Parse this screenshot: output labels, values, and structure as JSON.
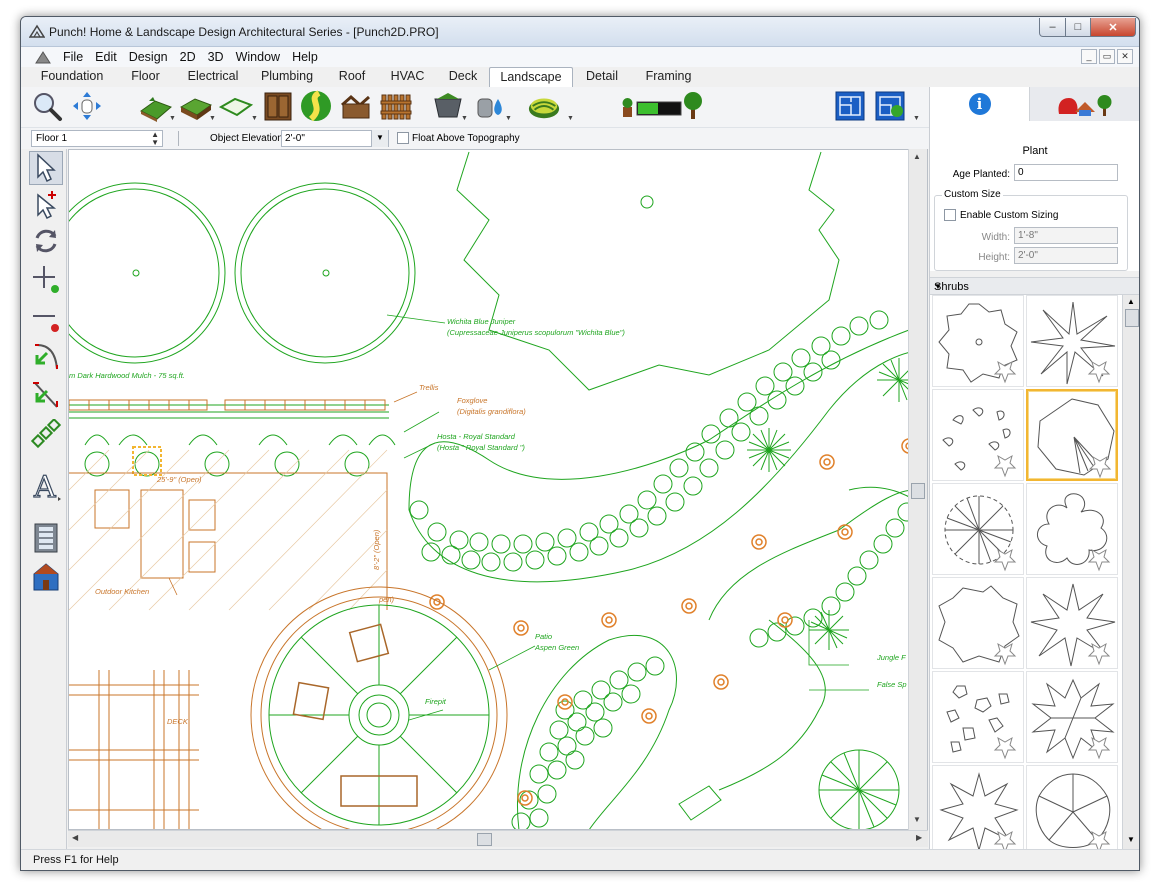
{
  "window": {
    "title": "Punch! Home & Landscape Design Architectural Series - [Punch2D.PRO]",
    "min": "–",
    "max": "□",
    "close": "✕"
  },
  "menu": [
    "File",
    "Edit",
    "Design",
    "2D",
    "3D",
    "Window",
    "Help"
  ],
  "mdi_buttons": [
    "_",
    "▭",
    "✕"
  ],
  "tabs": [
    {
      "label": "Foundation",
      "active": false
    },
    {
      "label": "Floor",
      "active": false
    },
    {
      "label": "Electrical",
      "active": false
    },
    {
      "label": "Plumbing",
      "active": false
    },
    {
      "label": "Roof",
      "active": false
    },
    {
      "label": "HVAC",
      "active": false
    },
    {
      "label": "Deck",
      "active": false
    },
    {
      "label": "Landscape",
      "active": true
    },
    {
      "label": "Detail",
      "active": false
    },
    {
      "label": "Framing",
      "active": false
    }
  ],
  "toolbar": {
    "tools": [
      "zoom-icon",
      "pan-icon",
      "terrain-icon",
      "raised-terrain-icon",
      "terrain-outline-icon",
      "cabinet-icon",
      "path-icon",
      "shed-icon",
      "fence-icon",
      "planter-icon",
      "water-icon",
      "ground-cover-icon",
      "plant-growth-icon",
      "blueprint-icon",
      "blueprint-plant-icon"
    ]
  },
  "options_bar": {
    "floor": "Floor 1",
    "elevation_label": "Object Elevation:",
    "elevation_value": "2'-0\"",
    "float_label": "Float Above Topography"
  },
  "canvas_labels": {
    "juniper_1": "Wichita Blue Juniper",
    "juniper_2": "(Cupressaceae Juniperus scopulorum \"Wichita Blue\")",
    "mulch": "m Dark Hardwood Mulch - 75 sq.ft.",
    "trellis": "Trellis",
    "foxglove_1": "Foxglove",
    "foxglove_2": "(Digitalis grandiflora)",
    "hosta_1": "Hosta - Royal Standard",
    "hosta_2": "(Hosta \" Royal Standard \")",
    "open_dim_1": "25'-9\" (Open)",
    "open_dim_2": "8'-2\" (Open)",
    "open_3": "pen)",
    "outdoor_kitchen": "Outdoor Kitchen",
    "patio_1": "Patio",
    "patio_2": "Aspen Green",
    "firepit": "Firepit",
    "deck": "DECK",
    "jungle": "Jungle F",
    "false_sp": "False Sp"
  },
  "status": "Press F1 for Help",
  "properties": {
    "title": "Plant",
    "age_label": "Age Planted:",
    "age_value": "0",
    "custom_size_label": "Custom Size",
    "enable_custom_label": "Enable Custom Sizing",
    "width_label": "Width:",
    "width_value": "1'-8\"",
    "height_label": "Height:",
    "height_value": "2'-0\""
  },
  "library": {
    "category": "Shrubs",
    "selected_index": 3
  },
  "colors": {
    "plan_green": "#1fa51f",
    "plan_orange": "#c8752a",
    "selection": "#f2b632",
    "info_blue": "#1f78d8"
  }
}
